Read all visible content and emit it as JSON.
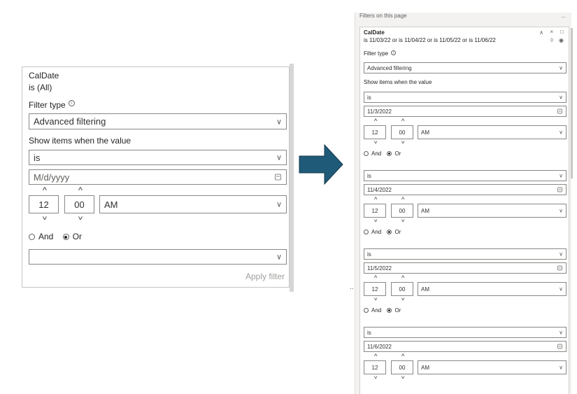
{
  "left": {
    "field": "CalDate",
    "summary": "is (All)",
    "filter_type_label": "Filter type",
    "filter_type_value": "Advanced filtering",
    "show_items_label": "Show items when the value",
    "condition": "is",
    "date_placeholder": "M/d/yyyy",
    "hour": "12",
    "minute": "00",
    "ampm": "AM",
    "and_label": "And",
    "or_label": "Or",
    "selected_logic": "Or",
    "second_condition": "",
    "apply": "Apply filter"
  },
  "right": {
    "header": "Filters on this page",
    "header_more": "...",
    "field": "CalDate",
    "summary": "is 11/03/22 or is 11/04/22 or is 11/05/22 or is 11/06/22",
    "filter_type_label": "Filter type",
    "filter_type_value": "Advanced filtering",
    "show_items_label": "Show items when the value",
    "conditions": [
      {
        "op": "is",
        "date": "11/3/2022",
        "hour": "12",
        "minute": "00",
        "ampm": "AM"
      },
      {
        "op": "is",
        "date": "11/4/2022",
        "hour": "12",
        "minute": "00",
        "ampm": "AM"
      },
      {
        "op": "is",
        "date": "11/5/2022",
        "hour": "12",
        "minute": "00",
        "ampm": "AM"
      },
      {
        "op": "is",
        "date": "11/6/2022",
        "hour": "12",
        "minute": "00",
        "ampm": "AM"
      }
    ],
    "and_label": "And",
    "or_label": "Or"
  },
  "separator": "..",
  "icons": {
    "arrow_color": "#1f5a78",
    "chevron": "chevron-down-icon",
    "calendar": "calendar-icon",
    "info": "info-icon"
  }
}
